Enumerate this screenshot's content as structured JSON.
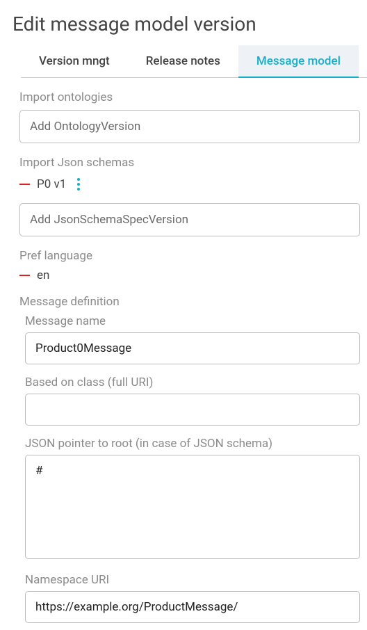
{
  "page": {
    "title": "Edit message model version"
  },
  "tabs": {
    "items": [
      {
        "label": "Version mngt",
        "active": false
      },
      {
        "label": "Release notes",
        "active": false
      },
      {
        "label": "Message model",
        "active": true
      }
    ]
  },
  "import_ontologies": {
    "label": "Import ontologies",
    "add_placeholder": "Add OntologyVersion"
  },
  "import_json_schemas": {
    "label": "Import Json schemas",
    "items": [
      {
        "label": "P0 v1"
      }
    ],
    "add_placeholder": "Add JsonSchemaSpecVersion"
  },
  "pref_language": {
    "label": "Pref language",
    "value": "en"
  },
  "message_definition": {
    "label": "Message definition",
    "message_name": {
      "label": "Message name",
      "value": "Product0Message"
    },
    "based_on_class": {
      "label": "Based on class (full URI)",
      "value": ""
    },
    "json_pointer": {
      "label": "JSON pointer to root (in case of JSON schema)",
      "value": "#"
    },
    "namespace_uri": {
      "label": "Namespace URI",
      "value": "https://example.org/ProductMessage/"
    }
  }
}
